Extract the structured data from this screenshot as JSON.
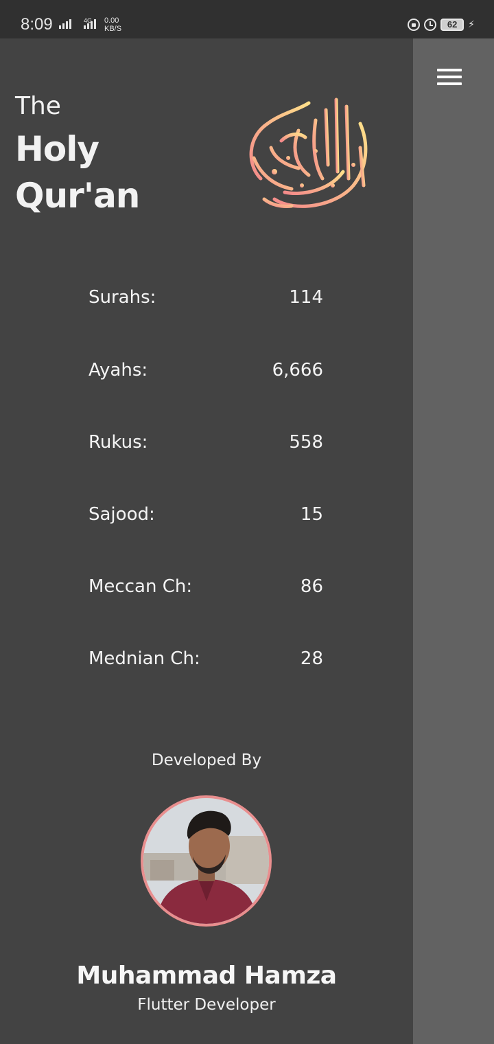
{
  "status_bar": {
    "time": "8:09",
    "network_type": "4G",
    "speed_value": "0.00",
    "speed_unit": "KB/S",
    "battery": "62"
  },
  "header": {
    "line1": "The",
    "line2": "Holy",
    "line3": "Qur'an"
  },
  "stats": [
    {
      "label": "Surahs:",
      "value": "114"
    },
    {
      "label": "Ayahs:",
      "value": "6,666"
    },
    {
      "label": "Rukus:",
      "value": "558"
    },
    {
      "label": "Sajood:",
      "value": "15"
    },
    {
      "label": "Meccan Ch:",
      "value": "86"
    },
    {
      "label": "Mednian Ch:",
      "value": "28"
    }
  ],
  "developer": {
    "heading": "Developed By",
    "name": "Muhammad Hamza",
    "role": "Flutter Developer"
  },
  "icons": {
    "menu": "hamburger-menu-icon",
    "logo": "quran-calligraphy-logo"
  },
  "colors": {
    "drawer_bg": "#434343",
    "scrim_bg": "#626262",
    "status_bg": "#303030",
    "avatar_ring": "#e88e8e",
    "logo_gradient_start": "#ffe08a",
    "logo_gradient_end": "#f48a8a"
  }
}
